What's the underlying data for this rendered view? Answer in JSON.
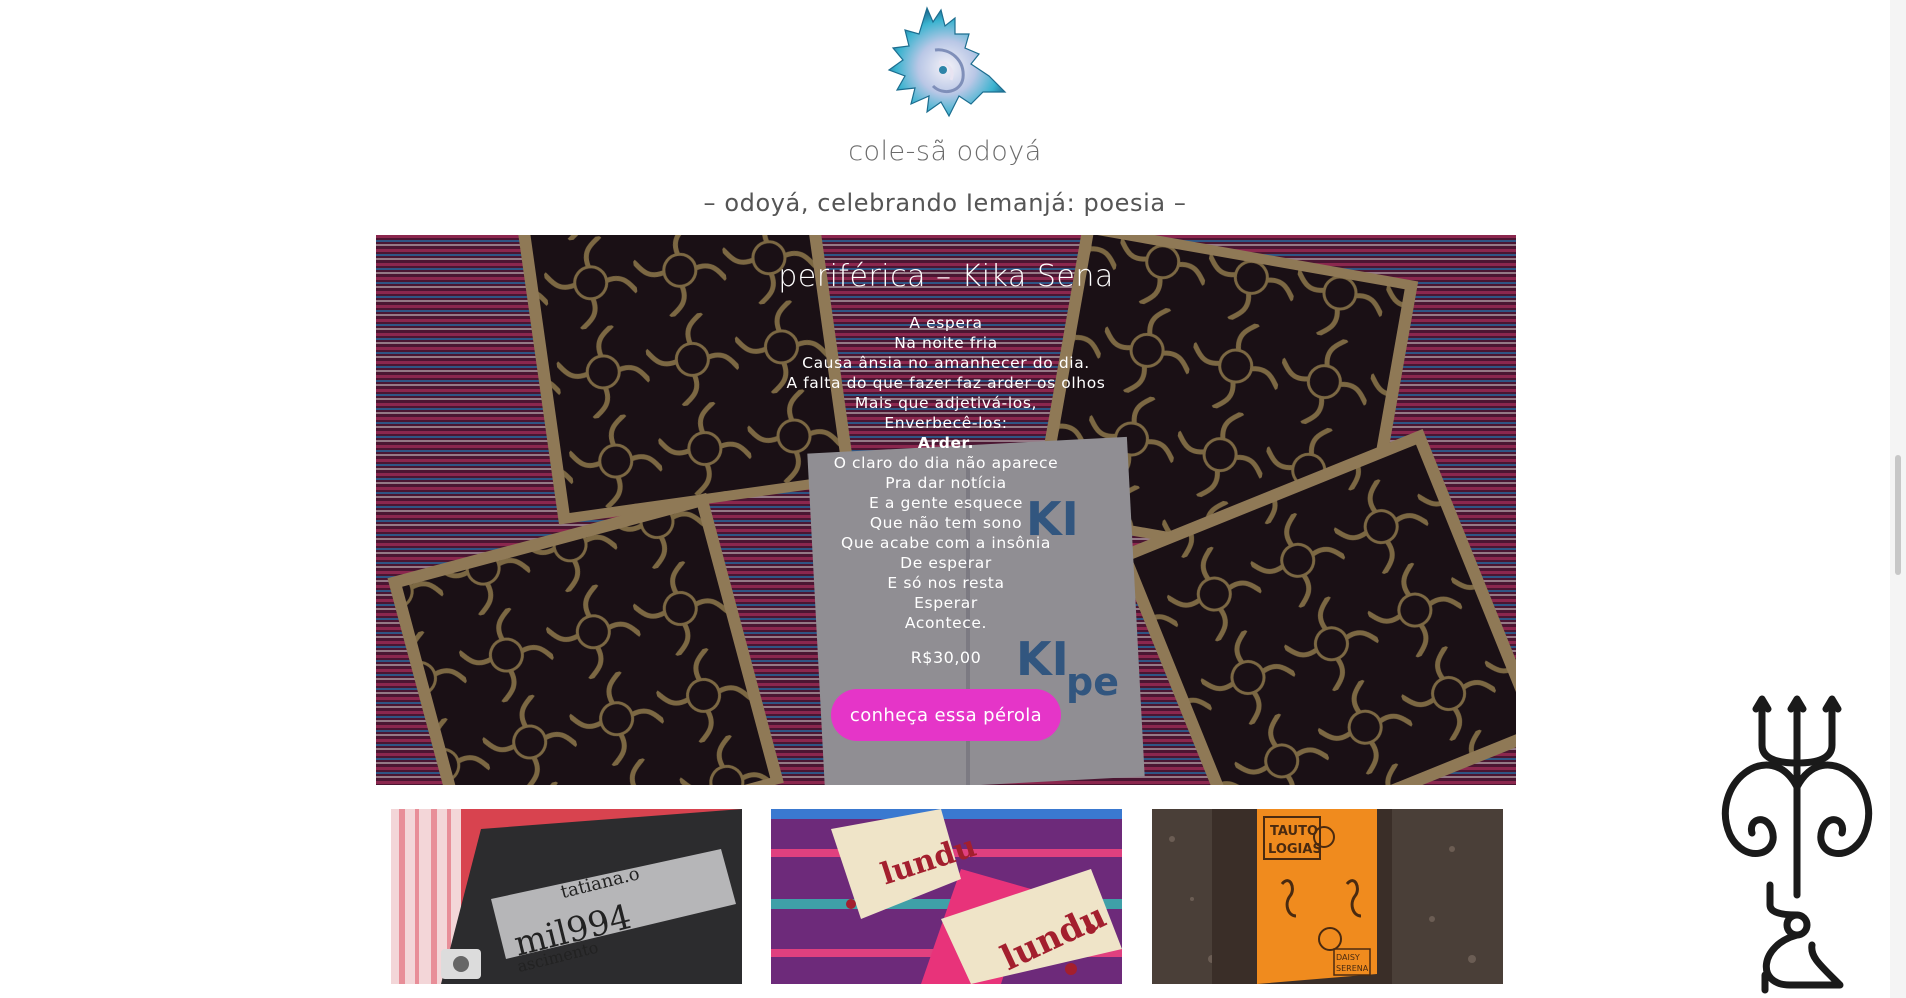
{
  "site": {
    "title": "cole-sã odoyá",
    "tagline": "– odoyá, celebrando Iemanjá: poesia –",
    "logo_icon": "conch-shell-icon"
  },
  "featured": {
    "title": "periférica – Kika Sena",
    "poem": [
      "A espera",
      "Na noite fria",
      "Causa ânsia no amanhecer do dia.",
      "A falta do que fazer faz arder os olhos",
      "Mais que adjetivá-los,",
      "Enverbecê-los:",
      "Arder.",
      "O claro do dia não aparece",
      "Pra dar notícia",
      "E a gente esquece",
      "Que não tem sono",
      "Que acabe com a insônia",
      "De esperar",
      "E só nos resta",
      "Esperar",
      "Acontece."
    ],
    "price": "R$30,00",
    "cta_label": "conheça essa pérola",
    "cta_color": "#e535c8"
  },
  "products": [
    {
      "cover_text": "tatiana.o mil994 ascimento"
    },
    {
      "cover_text": "lundu"
    },
    {
      "cover_text": "TAUTO LOGIAS",
      "author_text": "DAISY SERENA"
    }
  ],
  "ornament_icon": "trident-ornament-icon"
}
